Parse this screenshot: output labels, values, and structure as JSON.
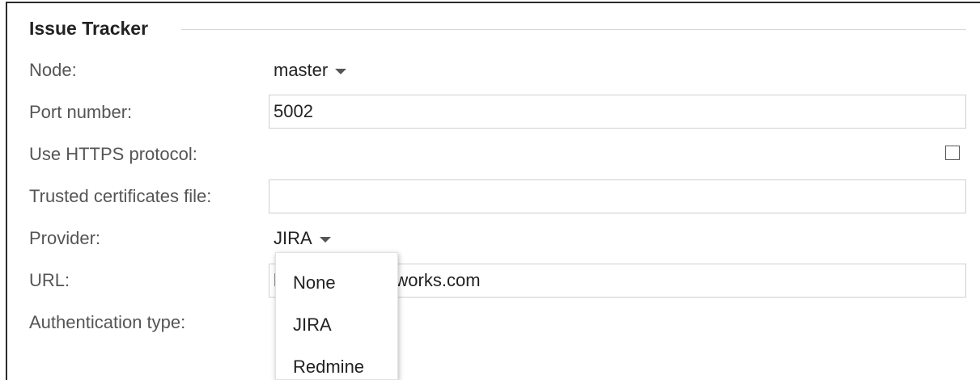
{
  "section": {
    "title": "Issue Tracker"
  },
  "fields": {
    "node": {
      "label": "Node:",
      "value": "master"
    },
    "port": {
      "label": "Port number:",
      "value": "5002"
    },
    "https": {
      "label": "Use HTTPS protocol:",
      "checked": false
    },
    "certs": {
      "label": "Trusted certificates file:",
      "value": ""
    },
    "provider": {
      "label": "Provider:",
      "value": "JIRA"
    },
    "url": {
      "label": "URL:",
      "value": "https://jira.mathworks.com"
    },
    "auth": {
      "label": "Authentication type:"
    }
  },
  "provider_menu": {
    "options": [
      "None",
      "JIRA",
      "Redmine"
    ]
  },
  "icons": {
    "dropdown": "caret-down-icon"
  },
  "colors": {
    "label": "#555555",
    "text": "#222222",
    "border": "#cfcfcf"
  }
}
